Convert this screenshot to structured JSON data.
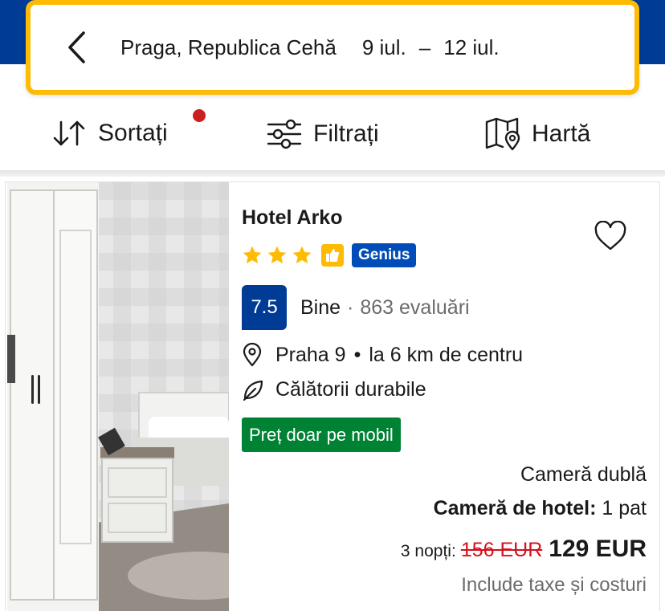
{
  "search": {
    "destination": "Praga, Republica Cehă",
    "checkin": "9 iul.",
    "separator": "–",
    "checkout": "12 iul."
  },
  "toolbar": {
    "sort_label": "Sortați",
    "filter_label": "Filtrați",
    "map_label": "Hartă",
    "sort_indicator_color": "#cc1f1f"
  },
  "hotel": {
    "name": "Hotel Arko",
    "stars": 3,
    "genius_label": "Genius",
    "score": "7.5",
    "score_label": "Bine",
    "score_separator": "·",
    "reviews": "863 evaluări",
    "district": "Praha 9",
    "location_separator": "•",
    "distance": "la 6 km de centru",
    "sustainability": "Călătorii durabile",
    "mobile_badge": "Preț doar pe mobil",
    "room_type": "Cameră dublă",
    "room_name": "Cameră de hotel:",
    "room_beds": "1 pat",
    "nights": "3 nopți:",
    "old_price": "156 EUR",
    "new_price": "129 EUR",
    "taxes_note": "Include taxe și costuri"
  },
  "icons": {
    "back": "chevron-left-icon",
    "sort": "sort-arrows-icon",
    "filter": "sliders-icon",
    "map": "map-pin-icon",
    "favorite": "heart-icon",
    "location": "location-pin-icon",
    "sustainability": "leaf-icon"
  },
  "colors": {
    "brand_blue": "#003b95",
    "accent_yellow": "#febb02",
    "genius_blue": "#004cb8",
    "deal_green": "#008234",
    "price_red": "#d4111e"
  }
}
